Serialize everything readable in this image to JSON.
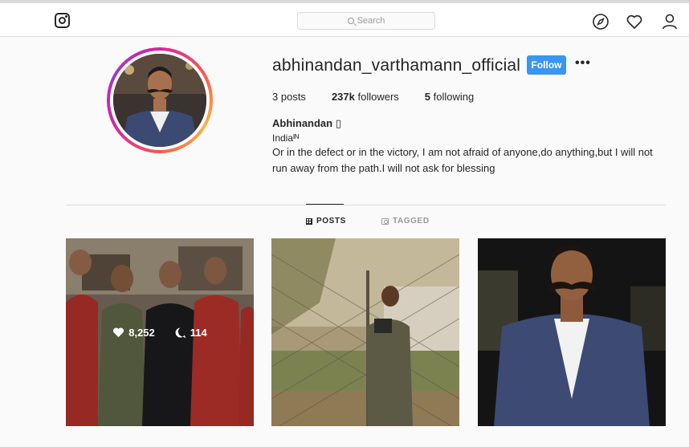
{
  "search": {
    "placeholder": "Search"
  },
  "profile": {
    "username": "abhinandan_varthamann_official",
    "follow_label": "Follow",
    "more_label": "•••",
    "stats": {
      "posts_count": "3",
      "posts_label": "posts",
      "followers_count": "237k",
      "followers_label": "followers",
      "following_count": "5",
      "following_label": "following"
    },
    "name": "Abhinandan ▯",
    "bio_country": "Indiaᴵᴺ",
    "bio_text": "Or in the defect or in the victory, I am not afraid of anyone,do anything,but I will not run away from the path.I will not ask for blessing"
  },
  "tabs": [
    {
      "label": "POSTS",
      "active": true
    },
    {
      "label": "TAGGED",
      "active": false
    }
  ],
  "posts": [
    {
      "likes": "8,252",
      "comments": "114",
      "hovered": true
    },
    {
      "likes": "",
      "comments": "",
      "hovered": false
    },
    {
      "likes": "",
      "comments": "",
      "hovered": false
    }
  ],
  "icons": {
    "logo": "instagram-icon",
    "explore": "compass-icon",
    "activity": "heart-icon",
    "profile": "user-icon"
  },
  "colors": {
    "accent": "#3897f0",
    "border": "#dbdbdb",
    "text": "#262626",
    "muted": "#999999"
  }
}
